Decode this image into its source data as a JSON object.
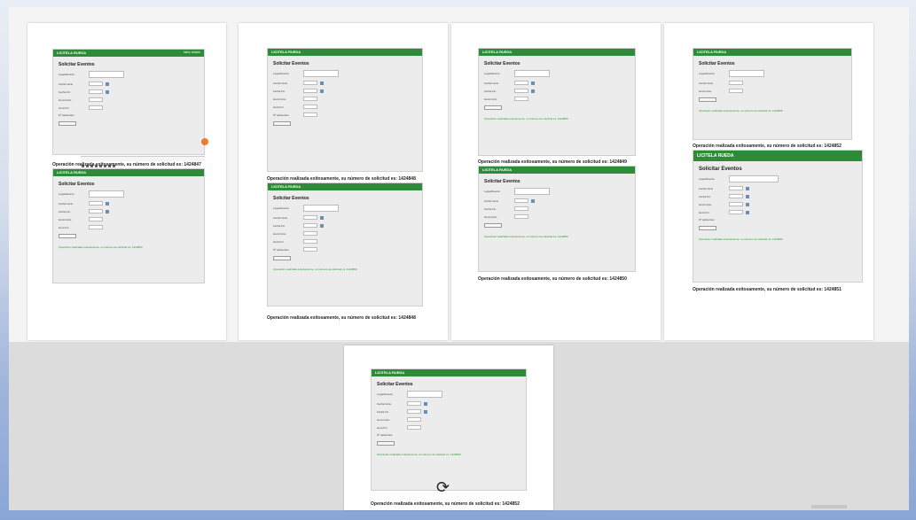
{
  "app": {
    "brand": "LICITELA RUEDA",
    "nav_items": [
      "Inicio sesión",
      "Mi cuenta",
      "Ayuda"
    ],
    "form_title": "Solicitar Eventos",
    "labels": {
      "lugar": "Lugar/Evento",
      "fecha_inicio": "Fecha Inicio",
      "fecha_fin": "Fecha Fin",
      "hora_inicio": "Hora Inicio",
      "hora_fin": "Hora Fin",
      "asistentes": "Nº asistentes"
    },
    "submit_label": "Enviar Evento",
    "success_msg": "Operación realizada exitosamente, su número de solicitud es: 1424860"
  },
  "captions": {
    "p1": "Operación realizada exitosamente, su número de solicitud es: 1424847",
    "p2a": "Operación realizada exitosamente, su número de solicitud es: 1424848",
    "p2b": "Operación realizada exitosamente, su número de solicitud es: 1424848",
    "p3a": "Operación realizada exitosamente, su número de solicitud es: 1424849",
    "p3b": "Operación realizada exitosamente, su número de solicitud es: 1424850",
    "p4a": "Operación realizada exitosamente, su número de solicitud es: 1424852",
    "p4b": "Operación realizada exitosamente, su número de solicitud es: 1424851",
    "p5": "Operación realizada exitosamente, su número de solicitud es: 1424852"
  },
  "colors": {
    "brand_green": "#2e8b3a",
    "page_bg": "#ffffff",
    "accent_orange": "#f07a2c"
  },
  "icons": {
    "cursor": "rotate-cursor-icon"
  }
}
